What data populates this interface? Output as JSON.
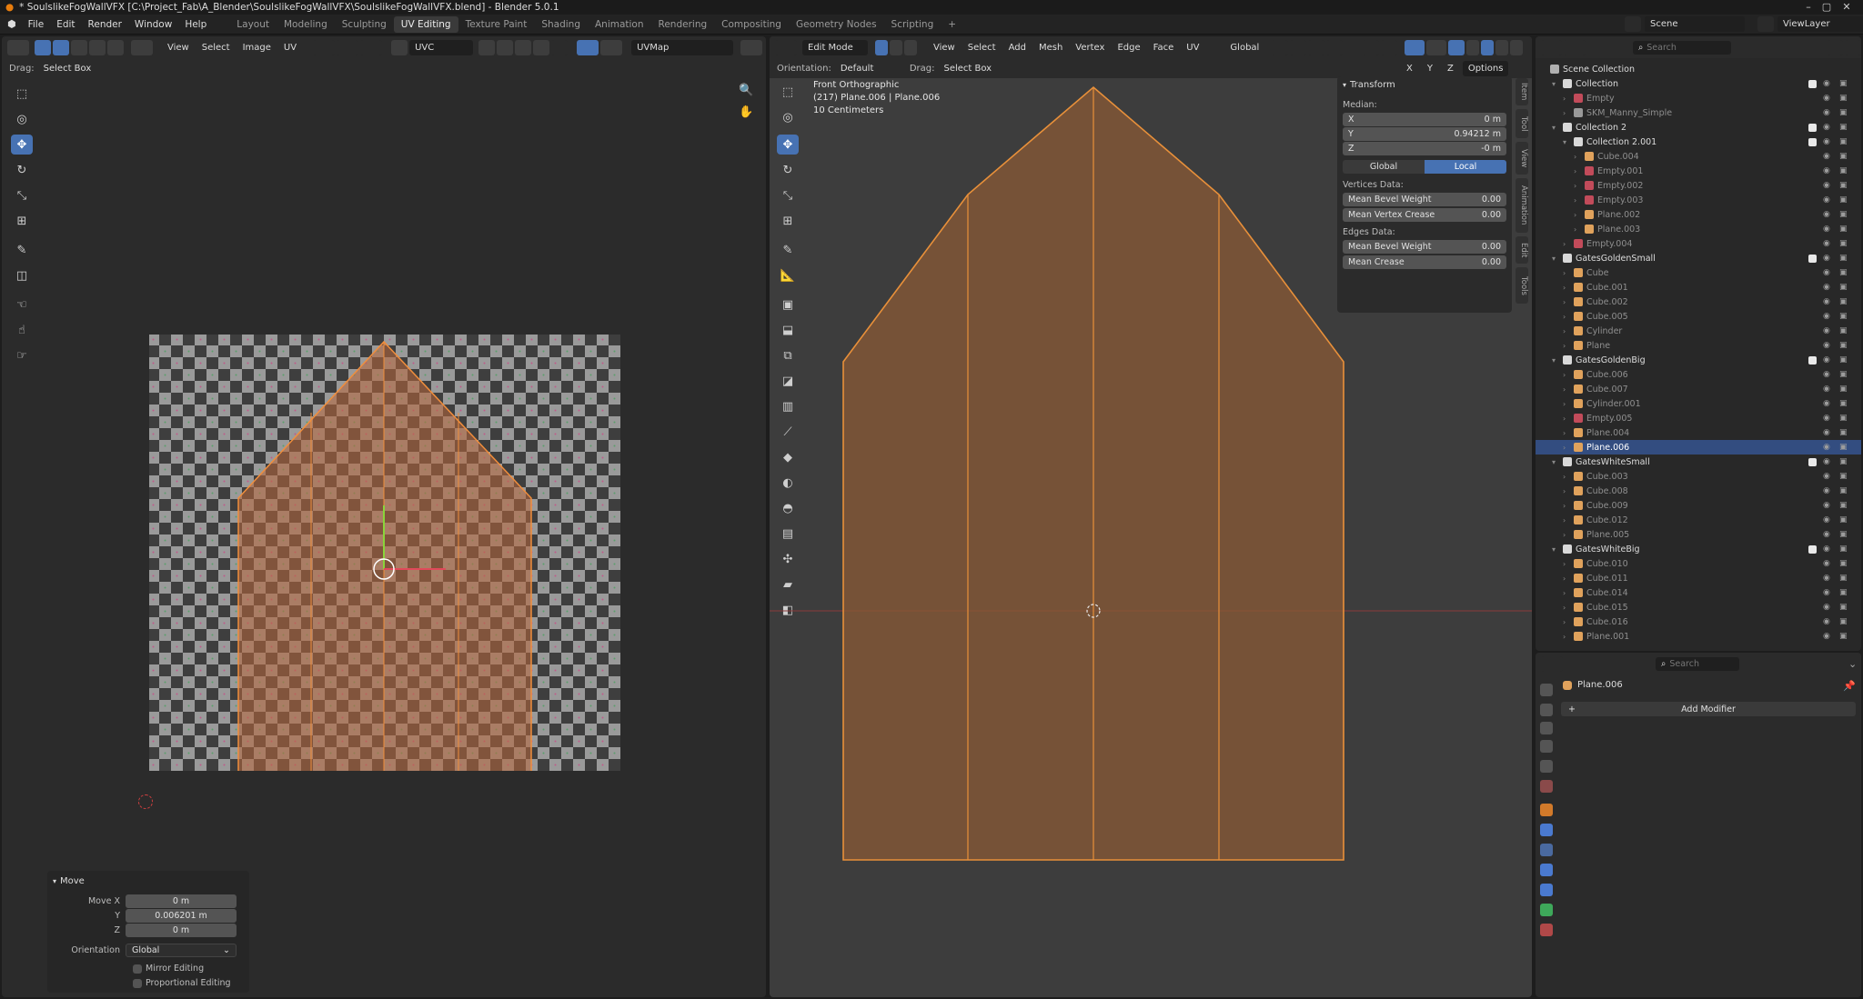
{
  "window": {
    "title": "* SoulslikeFogWallVFX [C:\\Project_Fab\\A_Blender\\SoulslikeFogWallVFX\\SoulslikeFogWallVFX.blend] - Blender 5.0.1"
  },
  "menu": [
    "File",
    "Edit",
    "Render",
    "Window",
    "Help"
  ],
  "workspaces": [
    "Layout",
    "Modeling",
    "Sculpting",
    "UV Editing",
    "Texture Paint",
    "Shading",
    "Animation",
    "Rendering",
    "Compositing",
    "Geometry Nodes",
    "Scripting"
  ],
  "active_workspace": "UV Editing",
  "scene": "Scene",
  "view_layer": "ViewLayer",
  "uv_editor": {
    "header_menus": [
      "View",
      "Select",
      "Image",
      "UV"
    ],
    "uv_map_label": "UVC",
    "image_name": "UVMap",
    "drag_label": "Drag:",
    "drag_value": "Select Box",
    "operator_panel": {
      "title": "Move",
      "move_x_label": "Move X",
      "move_x": "0 m",
      "y_label": "Y",
      "y": "0.006201 m",
      "z_label": "Z",
      "z": "0 m",
      "orientation_label": "Orientation",
      "orientation": "Global",
      "mirror": "Mirror Editing",
      "proportional": "Proportional Editing"
    }
  },
  "viewport": {
    "mode": "Edit Mode",
    "header_menus": [
      "View",
      "Select",
      "Add",
      "Mesh",
      "Vertex",
      "Edge",
      "Face",
      "UV"
    ],
    "transform_orientation": "Global",
    "orientation_label": "Orientation:",
    "orientation_value": "Default",
    "drag_label": "Drag:",
    "drag_value": "Select Box",
    "options": "Options",
    "axes": [
      "X",
      "Y",
      "Z"
    ],
    "overlay_title": "Front Orthographic",
    "overlay_object": "(217) Plane.006 | Plane.006",
    "overlay_scale": "10 Centimeters",
    "tabs": [
      "Item",
      "Tool",
      "View",
      "Animation",
      "Edit",
      "Tools"
    ],
    "transform_panel": {
      "title": "Transform",
      "median": "Median:",
      "x": "0 m",
      "y": "0.94212 m",
      "z": "-0 m",
      "global": "Global",
      "local": "Local",
      "vertices_data": "Vertices Data:",
      "mean_bevel_weight_label": "Mean Bevel Weight",
      "mean_bevel_weight": "0.00",
      "mean_vertex_crease_label": "Mean Vertex Crease",
      "mean_vertex_crease": "0.00",
      "edges_data": "Edges Data:",
      "edge_bevel_weight_label": "Mean Bevel Weight",
      "edge_bevel_weight": "0.00",
      "mean_crease_label": "Mean Crease",
      "mean_crease": "0.00"
    }
  },
  "outliner": {
    "search_placeholder": "Search",
    "root": "Scene Collection",
    "rows": [
      {
        "name": "Collection",
        "depth": 1,
        "type": "collection"
      },
      {
        "name": "Empty",
        "depth": 2,
        "type": "empty"
      },
      {
        "name": "SKM_Manny_Simple",
        "depth": 2,
        "type": "armature"
      },
      {
        "name": "Collection 2",
        "depth": 1,
        "type": "collection"
      },
      {
        "name": "Collection 2.001",
        "depth": 2,
        "type": "collection"
      },
      {
        "name": "Cube.004",
        "depth": 3,
        "type": "mesh"
      },
      {
        "name": "Empty.001",
        "depth": 3,
        "type": "empty"
      },
      {
        "name": "Empty.002",
        "depth": 3,
        "type": "empty"
      },
      {
        "name": "Empty.003",
        "depth": 3,
        "type": "empty"
      },
      {
        "name": "Plane.002",
        "depth": 3,
        "type": "mesh"
      },
      {
        "name": "Plane.003",
        "depth": 3,
        "type": "mesh"
      },
      {
        "name": "Empty.004",
        "depth": 2,
        "type": "empty"
      },
      {
        "name": "GatesGoldenSmall",
        "depth": 1,
        "type": "collection"
      },
      {
        "name": "Cube",
        "depth": 2,
        "type": "mesh"
      },
      {
        "name": "Cube.001",
        "depth": 2,
        "type": "mesh"
      },
      {
        "name": "Cube.002",
        "depth": 2,
        "type": "mesh"
      },
      {
        "name": "Cube.005",
        "depth": 2,
        "type": "mesh"
      },
      {
        "name": "Cylinder",
        "depth": 2,
        "type": "mesh"
      },
      {
        "name": "Plane",
        "depth": 2,
        "type": "mesh"
      },
      {
        "name": "GatesGoldenBig",
        "depth": 1,
        "type": "collection"
      },
      {
        "name": "Cube.006",
        "depth": 2,
        "type": "mesh"
      },
      {
        "name": "Cube.007",
        "depth": 2,
        "type": "mesh"
      },
      {
        "name": "Cylinder.001",
        "depth": 2,
        "type": "mesh"
      },
      {
        "name": "Empty.005",
        "depth": 2,
        "type": "empty"
      },
      {
        "name": "Plane.004",
        "depth": 2,
        "type": "mesh"
      },
      {
        "name": "Plane.006",
        "depth": 2,
        "type": "mesh",
        "active": true
      },
      {
        "name": "GatesWhiteSmall",
        "depth": 1,
        "type": "collection"
      },
      {
        "name": "Cube.003",
        "depth": 2,
        "type": "mesh"
      },
      {
        "name": "Cube.008",
        "depth": 2,
        "type": "mesh"
      },
      {
        "name": "Cube.009",
        "depth": 2,
        "type": "mesh"
      },
      {
        "name": "Cube.012",
        "depth": 2,
        "type": "mesh"
      },
      {
        "name": "Plane.005",
        "depth": 2,
        "type": "mesh"
      },
      {
        "name": "GatesWhiteBig",
        "depth": 1,
        "type": "collection"
      },
      {
        "name": "Cube.010",
        "depth": 2,
        "type": "mesh"
      },
      {
        "name": "Cube.011",
        "depth": 2,
        "type": "mesh"
      },
      {
        "name": "Cube.014",
        "depth": 2,
        "type": "mesh"
      },
      {
        "name": "Cube.015",
        "depth": 2,
        "type": "mesh"
      },
      {
        "name": "Cube.016",
        "depth": 2,
        "type": "mesh"
      },
      {
        "name": "Plane.001",
        "depth": 2,
        "type": "mesh"
      }
    ]
  },
  "properties": {
    "search_placeholder": "Search",
    "object_name": "Plane.006",
    "add_modifier": "Add Modifier"
  },
  "colors": {
    "accent": "#4772b3",
    "mesh_fill": "#8a5a36",
    "edge": "#e8903a",
    "collection": "#d9d9d9",
    "empty": "#c24b5a",
    "mesh": "#e0a25c"
  }
}
